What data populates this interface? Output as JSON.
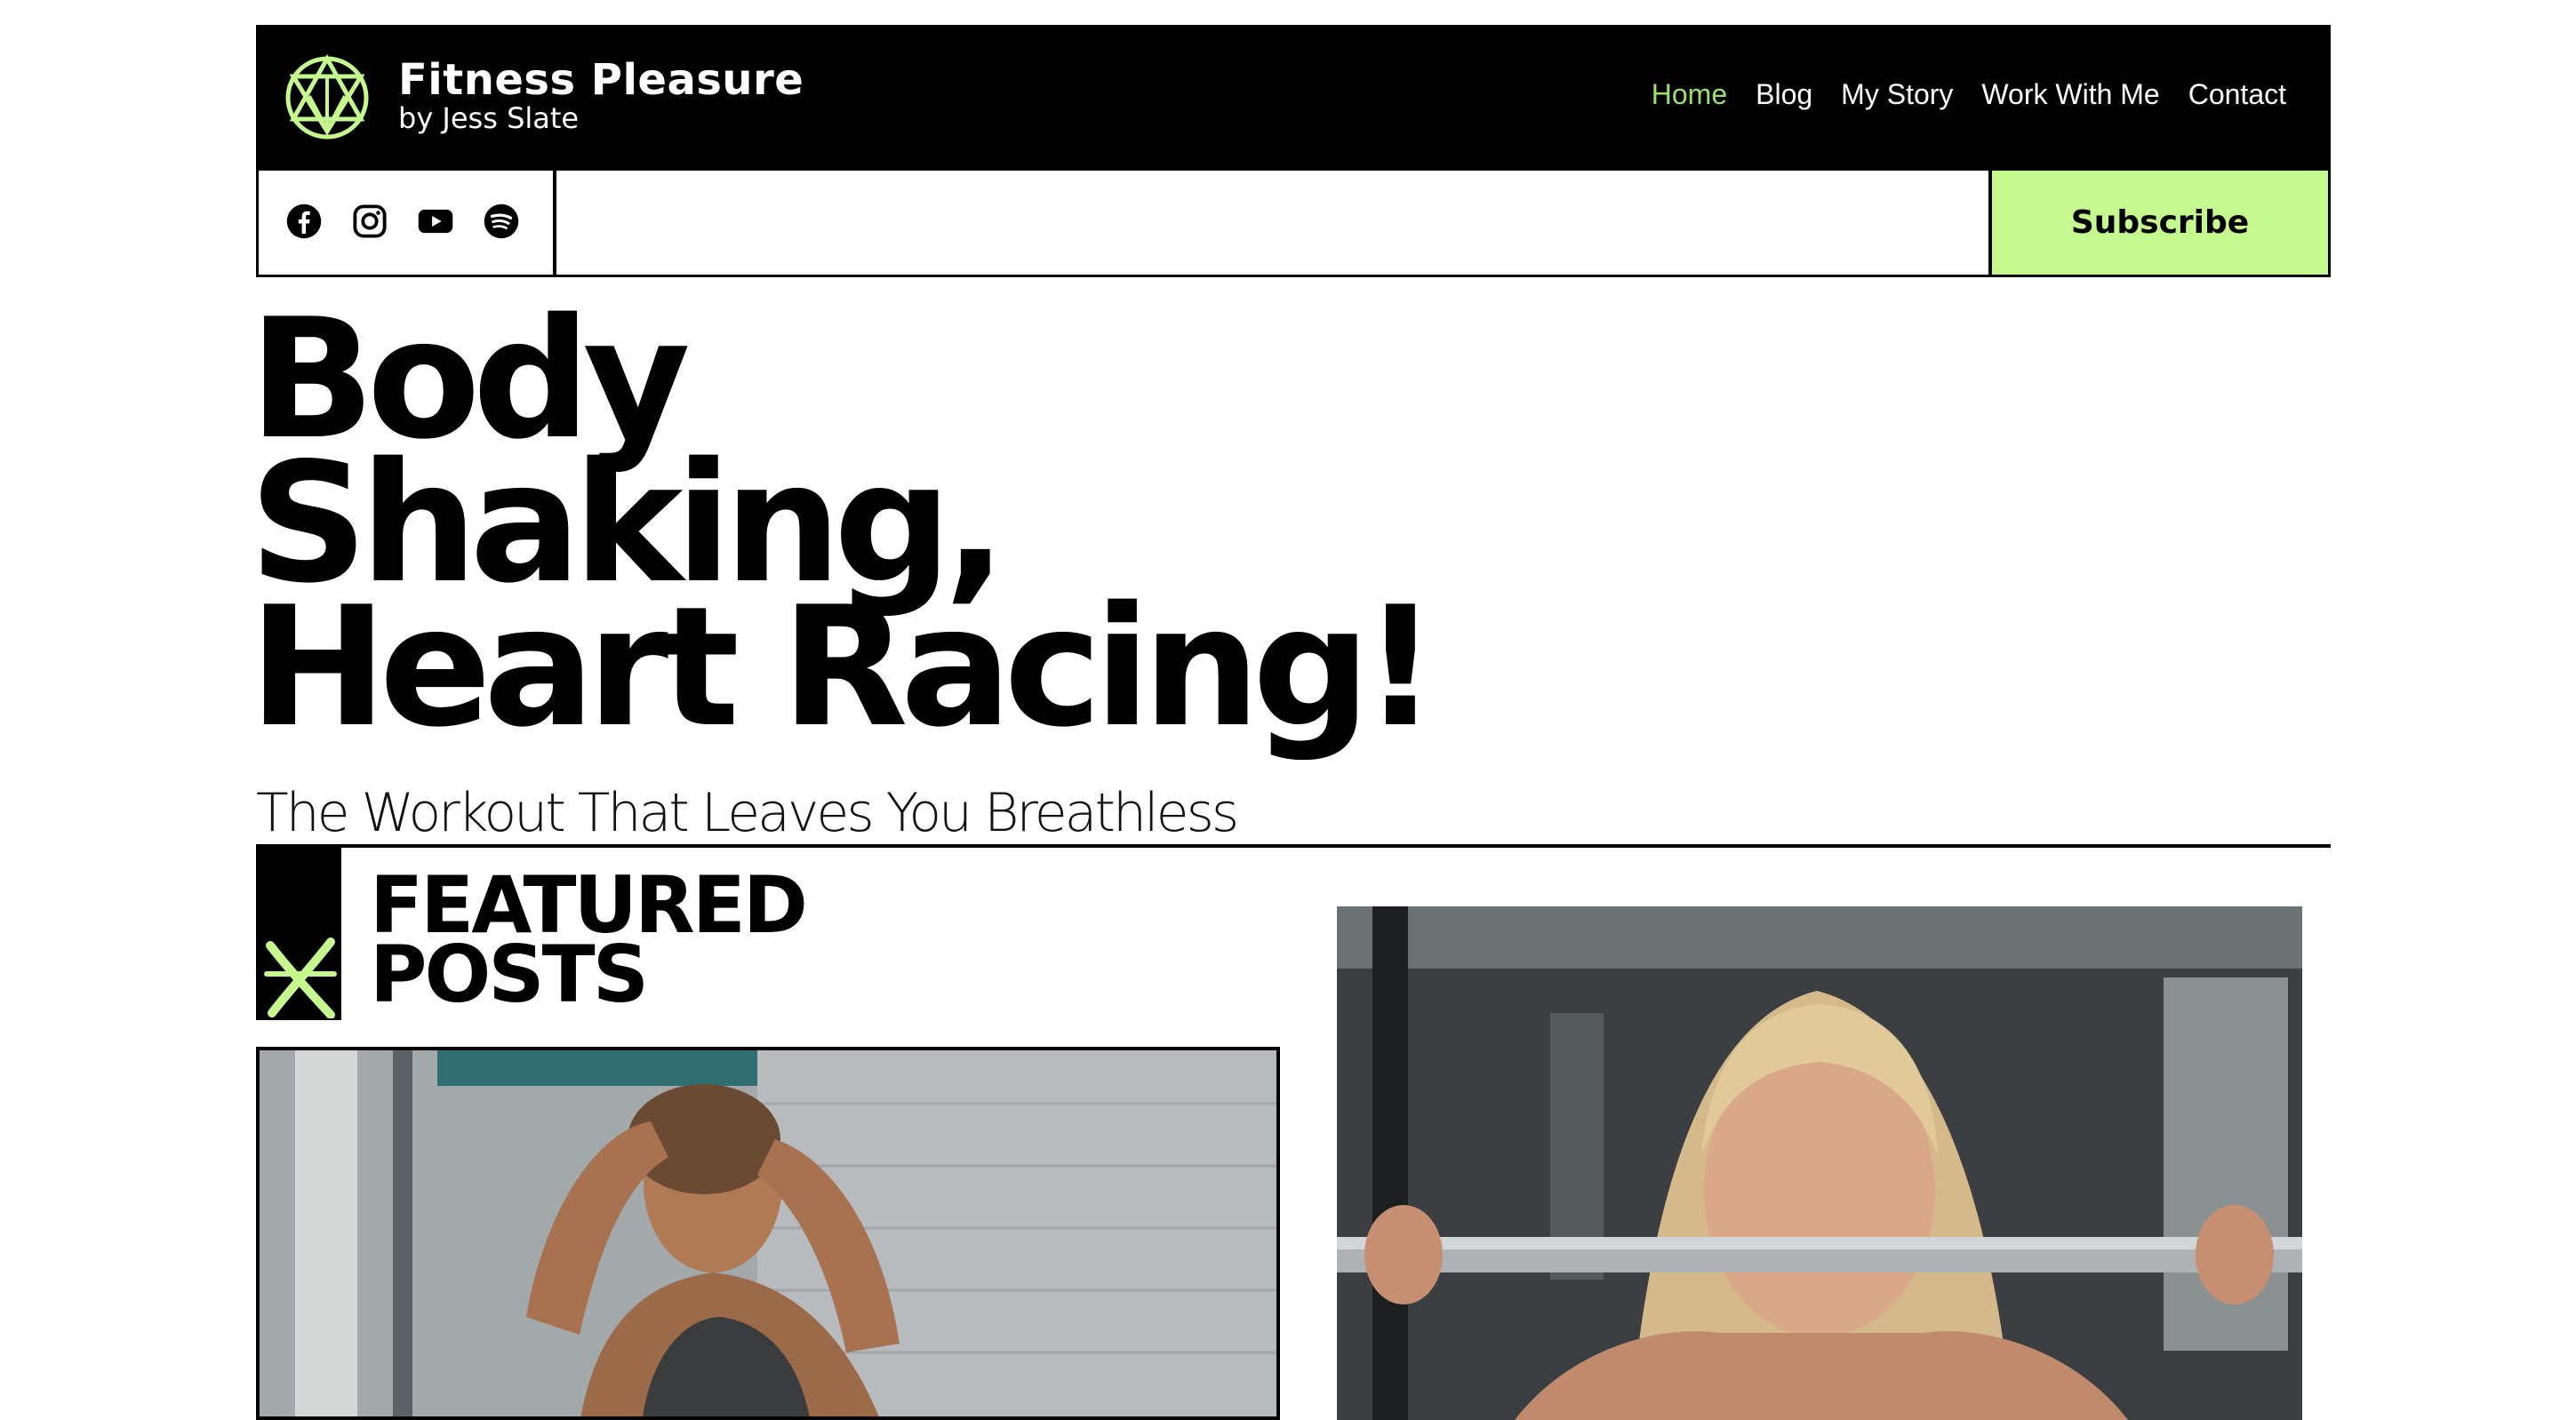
{
  "brand": {
    "title": "Fitness Pleasure",
    "subtitle": "by Jess Slate",
    "logo_icon": "triangle-star-icon",
    "accent": "#c5f98f",
    "nav_active_color": "#9be06f"
  },
  "nav": {
    "items": [
      {
        "label": "Home",
        "active": true
      },
      {
        "label": "Blog"
      },
      {
        "label": "My Story"
      },
      {
        "label": "Work With Me"
      },
      {
        "label": "Contact"
      }
    ]
  },
  "social": {
    "icons": [
      "facebook-icon",
      "instagram-icon",
      "youtube-icon",
      "spotify-icon"
    ]
  },
  "subscribe": {
    "label": "Subscribe"
  },
  "hero": {
    "title_lines": [
      "Body",
      "Shaking,",
      "Heart Racing!"
    ],
    "subtitle": "The Workout That Leaves You Breathless"
  },
  "featured": {
    "title_lines": [
      "FEATURED",
      "POSTS"
    ],
    "decoration_icon": "x-mark-icon"
  },
  "posts": {
    "left_image": "woman-sweating-workout-photo",
    "right_image": "woman-barbell-gym-photo"
  }
}
